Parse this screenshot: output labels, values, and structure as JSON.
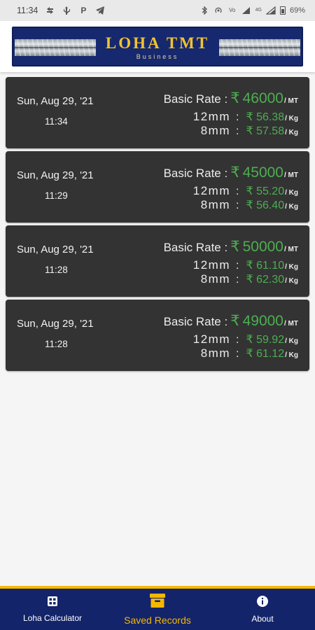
{
  "status_bar": {
    "time": "11:34",
    "battery": "69%",
    "network": "4G",
    "left_icons": [
      "sync-icon",
      "usb-icon",
      "parking-icon",
      "telegram-icon"
    ],
    "right_icons": [
      "bluetooth-icon",
      "hotspot-icon",
      "volte-icon",
      "signal-icon",
      "wifi-icon",
      "battery-icon"
    ]
  },
  "header": {
    "brand_title": "LOHA TMT",
    "brand_subtitle": "Business"
  },
  "records": [
    {
      "date": "Sun, Aug 29, '21",
      "time": "11:34",
      "basic_label": "Basic Rate :",
      "currency": "₹",
      "basic_value": "46000",
      "basic_unit": "/ MT",
      "size12_label": "12mm",
      "colon": ":",
      "size12_price": "₹ 56.38",
      "size12_unit": "/ Kg",
      "size8_label": "8mm",
      "size8_price": "₹ 57.58",
      "size8_unit": "/ Kg"
    },
    {
      "date": "Sun, Aug 29, '21",
      "time": "11:29",
      "basic_label": "Basic Rate :",
      "currency": "₹",
      "basic_value": "45000",
      "basic_unit": "/ MT",
      "size12_label": "12mm",
      "colon": ":",
      "size12_price": "₹ 55.20",
      "size12_unit": "/ Kg",
      "size8_label": "8mm",
      "size8_price": "₹ 56.40",
      "size8_unit": "/ Kg"
    },
    {
      "date": "Sun, Aug 29, '21",
      "time": "11:28",
      "basic_label": "Basic Rate :",
      "currency": "₹",
      "basic_value": "50000",
      "basic_unit": "/ MT",
      "size12_label": "12mm",
      "colon": ":",
      "size12_price": "₹ 61.10",
      "size12_unit": "/ Kg",
      "size8_label": "8mm",
      "size8_price": "₹ 62.30",
      "size8_unit": "/ Kg"
    },
    {
      "date": "Sun, Aug 29, '21",
      "time": "11:28",
      "basic_label": "Basic Rate :",
      "currency": "₹",
      "basic_value": "49000",
      "basic_unit": "/ MT",
      "size12_label": "12mm",
      "colon": ":",
      "size12_price": "₹ 59.92",
      "size12_unit": "/ Kg",
      "size8_label": "8mm",
      "size8_price": "₹ 61.12",
      "size8_unit": "/ Kg"
    }
  ],
  "bottom_nav": {
    "items": [
      {
        "label": "Loha Calculator",
        "icon": "calculator-icon",
        "active": false
      },
      {
        "label": "Saved Records",
        "icon": "archive-box-icon",
        "active": true
      },
      {
        "label": "About",
        "icon": "info-icon",
        "active": false
      }
    ]
  },
  "colors": {
    "brand_navy": "#14246a",
    "accent_yellow": "#f5b800",
    "card_bg": "#333333",
    "price_green": "#4caf50"
  }
}
